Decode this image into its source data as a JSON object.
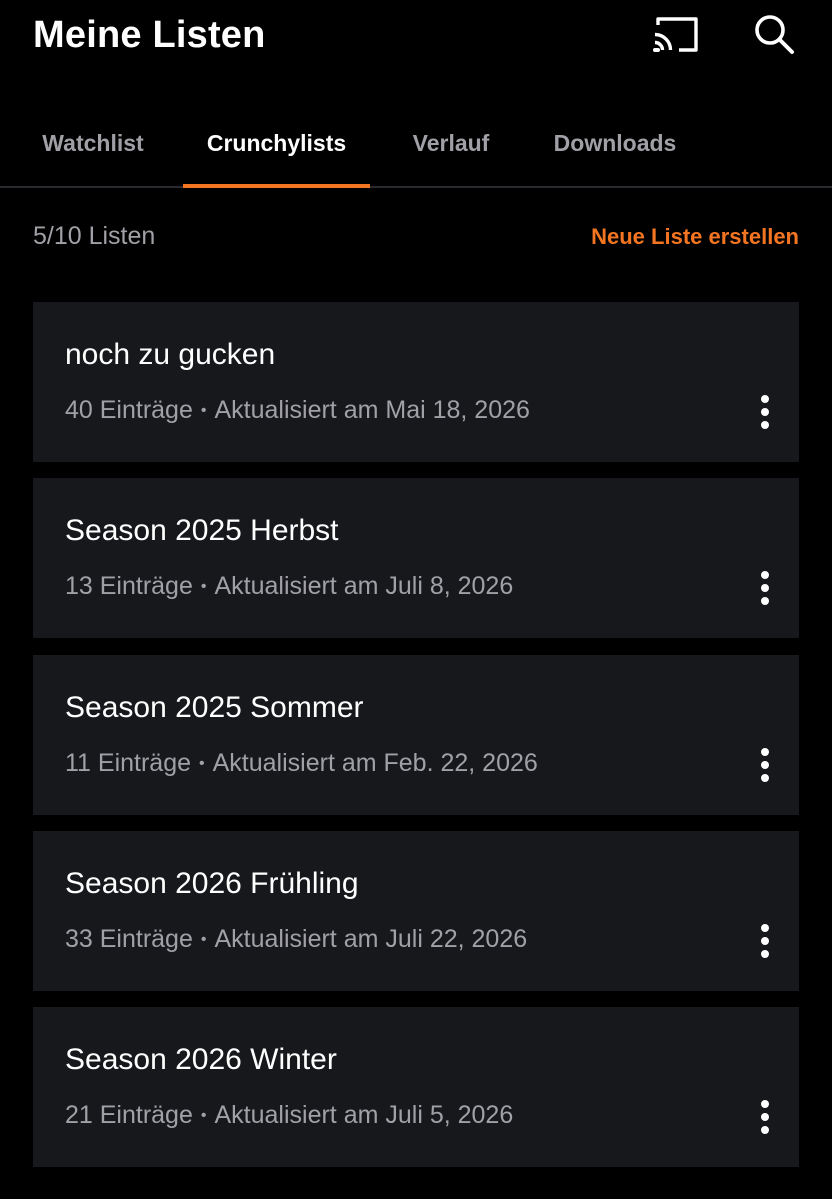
{
  "header": {
    "title": "Meine Listen",
    "cast_icon": "cast-icon",
    "search_icon": "search-icon"
  },
  "tabs": [
    {
      "label": "Watchlist",
      "active": false
    },
    {
      "label": "Crunchylists",
      "active": true
    },
    {
      "label": "Verlauf",
      "active": false
    },
    {
      "label": "Downloads",
      "active": false
    }
  ],
  "summary": {
    "count": "5/10 Listen",
    "new_list": "Neue Liste erstellen"
  },
  "lists": [
    {
      "title": "noch zu gucken",
      "entries": "40 Einträge",
      "updated": "Aktualisiert am Mai 18, 2026"
    },
    {
      "title": "Season 2025 Herbst",
      "entries": "13 Einträge",
      "updated": "Aktualisiert am Juli 8, 2026"
    },
    {
      "title": "Season 2025 Sommer",
      "entries": "11 Einträge",
      "updated": "Aktualisiert am Feb. 22, 2026"
    },
    {
      "title": "Season 2026 Frühling",
      "entries": "33 Einträge",
      "updated": "Aktualisiert am Juli 22, 2026"
    },
    {
      "title": "Season 2026 Winter",
      "entries": "21 Einträge",
      "updated": "Aktualisiert am Juli 5, 2026"
    }
  ],
  "meta_separator": "•",
  "more_icon": "more-vertical-icon",
  "colors": {
    "accent": "#f47521",
    "background": "#000000",
    "card": "#17181c",
    "muted_text": "#a0a0a6"
  }
}
